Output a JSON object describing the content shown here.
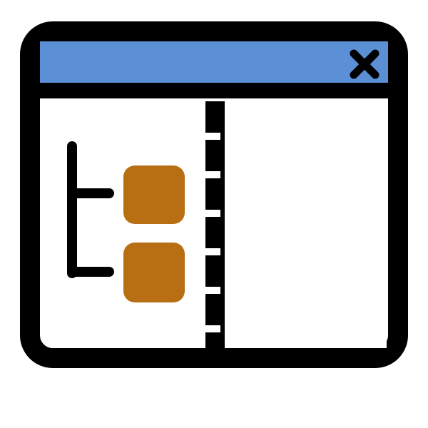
{
  "icon": {
    "name": "split-pane-window-tree-icon",
    "parts": {
      "window": "window-frame",
      "title_bar": "title-bar",
      "close": "close-icon",
      "tree": "tree-connector",
      "nodes": [
        "tree-node",
        "tree-node"
      ],
      "splitter": "splitter-dashed-divider",
      "right_pane": "right-pane"
    }
  },
  "colors": {
    "frame": "#000000",
    "title_bar": "#5b8fd6",
    "node": "#b86e12",
    "background": "#ffffff",
    "pane": "#ffffff"
  }
}
